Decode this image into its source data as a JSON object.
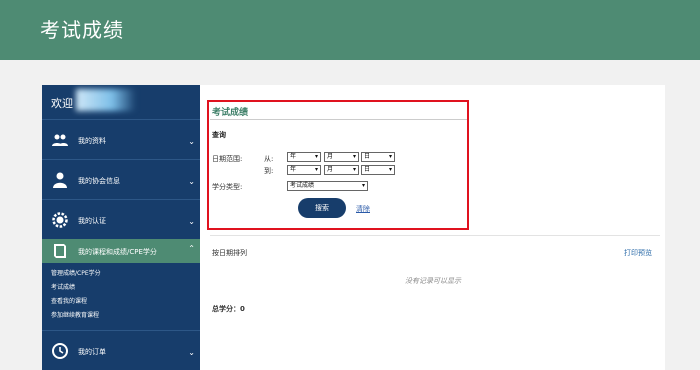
{
  "header": {
    "title": "考试成绩"
  },
  "sidebar": {
    "welcome": "欢迎",
    "items": [
      {
        "label": "我的资料",
        "icon": "users-icon"
      },
      {
        "label": "我的协会信息",
        "icon": "user-icon"
      },
      {
        "label": "我的认证",
        "icon": "gear-icon"
      },
      {
        "label": "我的课程和成绩/CPE学分",
        "icon": "book-icon"
      },
      {
        "label": "我的订单",
        "icon": "history-icon"
      }
    ],
    "subitems": [
      "管理成绩/CPE学分",
      "考试成绩",
      "查看我的课程",
      "参加继续教育课程"
    ]
  },
  "form": {
    "title": "考试成绩",
    "query_label": "查询",
    "date_range_label": "日期范围:",
    "from_label": "从:",
    "to_label": "到:",
    "year": "年",
    "month": "月",
    "day": "日",
    "credit_type_label": "学分类型:",
    "credit_type_value": "考试成绩",
    "search_button": "搜索",
    "clear_link": "清除"
  },
  "results": {
    "sort_label": "按日期排列",
    "print_link": "打印预览",
    "empty_text": "没有记录可以显示",
    "total": "总学分：0"
  },
  "colors": {
    "header": "#4e8b73",
    "sidebar": "#173d6b",
    "accent": "#e0121f"
  }
}
